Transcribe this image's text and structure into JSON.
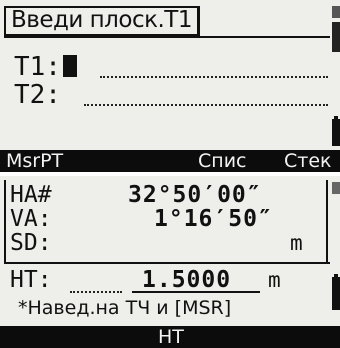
{
  "screen1": {
    "title": "Введи плоск.Т1",
    "fields": [
      {
        "label": "T1:"
      },
      {
        "label": "T2:"
      }
    ],
    "softkeys": [
      "MsrPT",
      "Спис",
      "Стек"
    ]
  },
  "screen2": {
    "rows": [
      {
        "label": "HA#",
        "value": "32°50′00″",
        "unit": ""
      },
      {
        "label": "VA:",
        "value": "1°16′50″",
        "unit": ""
      },
      {
        "label": "SD:",
        "value": "",
        "unit": "m"
      }
    ],
    "height": {
      "label": "HT:",
      "value": "1.5000",
      "unit": "m"
    },
    "message": "*Навед.на ТЧ и [MSR]",
    "softkey": "HT"
  },
  "icons": {
    "scroll": "scroll-indicator-icon",
    "battery": "battery-icon"
  }
}
